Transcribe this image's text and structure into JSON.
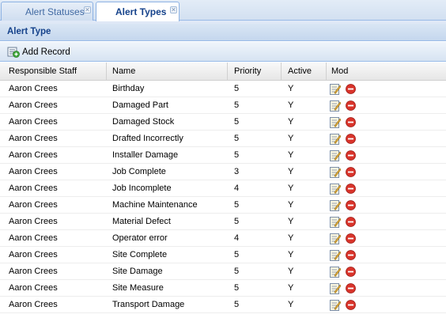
{
  "tabs": [
    {
      "label": "Alert Statuses",
      "close": "✕"
    },
    {
      "label": "Alert Types",
      "close": "✕"
    }
  ],
  "panel": {
    "title": "Alert Type"
  },
  "toolbar": {
    "add_label": "Add Record"
  },
  "grid": {
    "columns": [
      "Responsible Staff",
      "Name",
      "Priority",
      "Active",
      "Mod"
    ],
    "rows": [
      {
        "staff": "Aaron Crees",
        "name": "Birthday",
        "priority": "5",
        "active": "Y"
      },
      {
        "staff": "Aaron Crees",
        "name": "Damaged Part",
        "priority": "5",
        "active": "Y"
      },
      {
        "staff": "Aaron Crees",
        "name": "Damaged Stock",
        "priority": "5",
        "active": "Y"
      },
      {
        "staff": "Aaron Crees",
        "name": "Drafted Incorrectly",
        "priority": "5",
        "active": "Y"
      },
      {
        "staff": "Aaron Crees",
        "name": "Installer Damage",
        "priority": "5",
        "active": "Y"
      },
      {
        "staff": "Aaron Crees",
        "name": "Job Complete",
        "priority": "3",
        "active": "Y"
      },
      {
        "staff": "Aaron Crees",
        "name": "Job Incomplete",
        "priority": "4",
        "active": "Y"
      },
      {
        "staff": "Aaron Crees",
        "name": "Machine Maintenance",
        "priority": "5",
        "active": "Y"
      },
      {
        "staff": "Aaron Crees",
        "name": "Material Defect",
        "priority": "5",
        "active": "Y"
      },
      {
        "staff": "Aaron Crees",
        "name": "Operator error",
        "priority": "4",
        "active": "Y"
      },
      {
        "staff": "Aaron Crees",
        "name": "Site Complete",
        "priority": "5",
        "active": "Y"
      },
      {
        "staff": "Aaron Crees",
        "name": "Site Damage",
        "priority": "5",
        "active": "Y"
      },
      {
        "staff": "Aaron Crees",
        "name": "Site Measure",
        "priority": "5",
        "active": "Y"
      },
      {
        "staff": "Aaron Crees",
        "name": "Transport Damage",
        "priority": "5",
        "active": "Y"
      }
    ]
  },
  "icons": {
    "edit": "edit-icon",
    "delete": "delete-icon",
    "add": "add-record-icon"
  },
  "colors": {
    "header_text": "#15428b",
    "border": "#99bbe8",
    "delete_red": "#d9342b"
  }
}
